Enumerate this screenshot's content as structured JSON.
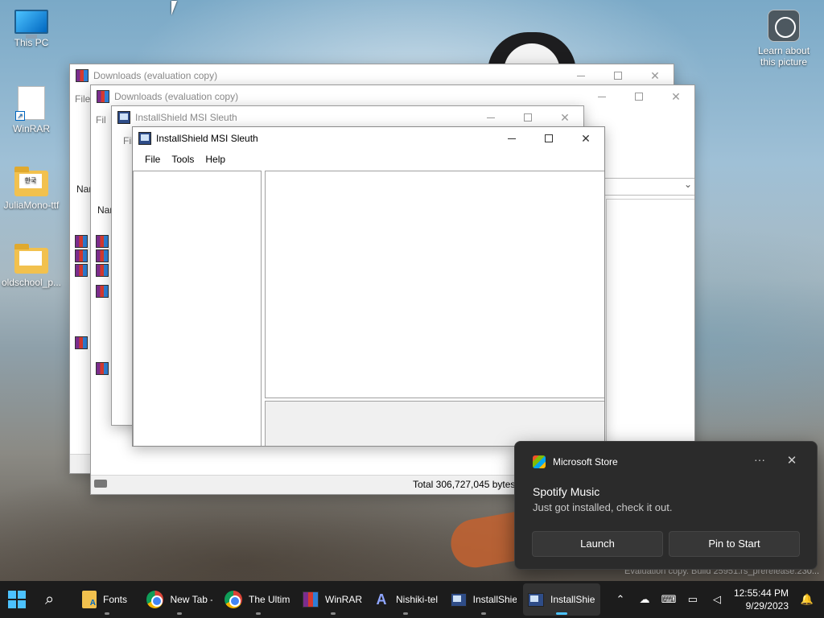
{
  "desktop": {
    "icons": [
      {
        "label": "This PC",
        "icon": "monitor-icon"
      },
      {
        "label": "WinRAR",
        "icon": "shortcut-document-icon"
      },
      {
        "label": "JuliaMono-ttf",
        "icon": "folder-icon",
        "folder_badge": "한국"
      },
      {
        "label": "oldschool_p...",
        "icon": "folder-icon",
        "folder_badge": ""
      }
    ],
    "learn_label": "Learn about this picture",
    "watermark": "Evaluation copy. Build 25951.rs_prerelease.230..."
  },
  "windows": {
    "downloads_back": {
      "title": "Downloads (evaluation copy)",
      "menu_partial": "File",
      "col_partial": "Nar"
    },
    "downloads_front": {
      "title": "Downloads (evaluation copy)",
      "menu_partial": "Fil",
      "col_partial": "Nar",
      "status_text": "Total 306,727,045 bytes i"
    },
    "sleuth_back": {
      "title": "InstallShield MSI Sleuth",
      "menu_partial": "Fil"
    },
    "sleuth_main": {
      "title": "InstallShield MSI Sleuth",
      "menu": [
        "File",
        "Tools",
        "Help"
      ]
    }
  },
  "toast": {
    "app": "Microsoft Store",
    "more": "···",
    "title": "Spotify Music",
    "body": "Just got installed, check it out.",
    "launch": "Launch",
    "pin": "Pin to Start"
  },
  "taskbar": {
    "items": [
      {
        "label": "Fonts",
        "icon": "folder-fonts-icon"
      },
      {
        "label": "New Tab -",
        "icon": "chrome-icon"
      },
      {
        "label": "The Ultim",
        "icon": "chrome-icon"
      },
      {
        "label": "WinRAR",
        "icon": "winrar-icon"
      },
      {
        "label": "Nishiki-tel",
        "icon": "nishiki-icon"
      },
      {
        "label": "InstallShie",
        "icon": "installshield-icon"
      },
      {
        "label": "InstallShie",
        "icon": "installshield-icon"
      }
    ],
    "time": "12:55:44 PM",
    "date": "9/29/2023"
  },
  "colors": {
    "accent": "#4cc2ff",
    "taskbar": "#1c1c1c",
    "toast": "#2b2b2b"
  }
}
